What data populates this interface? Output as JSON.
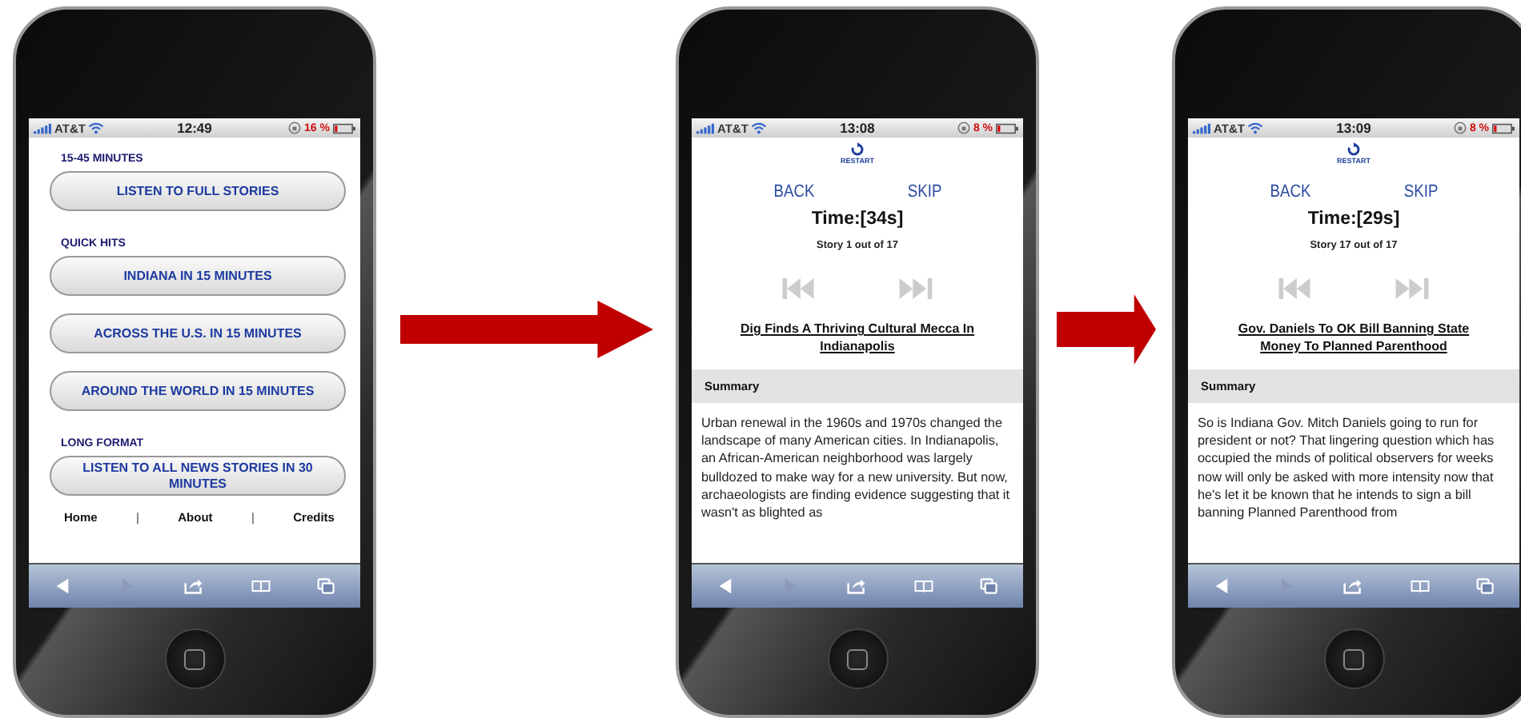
{
  "phones": [
    {
      "kind": "menu",
      "status": {
        "carrier": "AT&T",
        "time": "12:49",
        "battery": "16 %"
      },
      "sections": [
        {
          "heading": "15-45 MINUTES",
          "buttons": [
            "LISTEN TO FULL STORIES"
          ]
        },
        {
          "heading": "QUICK HITS",
          "buttons": [
            "INDIANA IN 15 MINUTES",
            "ACROSS THE U.S. IN 15 MINUTES",
            "AROUND THE WORLD IN 15 MINUTES"
          ]
        },
        {
          "heading": "LONG FORMAT",
          "buttons": [
            "LISTEN TO ALL NEWS STORIES IN 30 MINUTES"
          ]
        }
      ],
      "footer": [
        "Home",
        "|",
        "About",
        "|",
        "Credits"
      ]
    },
    {
      "kind": "story",
      "status": {
        "carrier": "AT&T",
        "time": "13:08",
        "battery": "8 %"
      },
      "restart": "RESTART",
      "back": "BACK",
      "skip": "SKIP",
      "timer": "Time:[34s]",
      "counter": "Story 1 out of 17",
      "headline": "Dig Finds A Thriving Cultural Mecca In Indianapolis",
      "summary_heading": "Summary",
      "summary": "Urban renewal in the 1960s and 1970s changed the landscape of many American cities. In Indianapolis, an African-American neighborhood was largely bulldozed to make way for a new university. But now, archaeologists are finding evidence suggesting that it wasn't as blighted as"
    },
    {
      "kind": "story",
      "status": {
        "carrier": "AT&T",
        "time": "13:09",
        "battery": "8 %"
      },
      "restart": "RESTART",
      "back": "BACK",
      "skip": "SKIP",
      "timer": "Time:[29s]",
      "counter": "Story 17 out of 17",
      "headline": "Gov. Daniels To OK Bill Banning State Money To Planned Parenthood",
      "summary_heading": "Summary",
      "summary": "So is Indiana Gov. Mitch Daniels going to run for president or not? That lingering question which has occupied the minds of political observers for weeks now will only be asked with more intensity now that he's let it be known that he intends to sign a bill banning Planned Parenthood from"
    }
  ]
}
